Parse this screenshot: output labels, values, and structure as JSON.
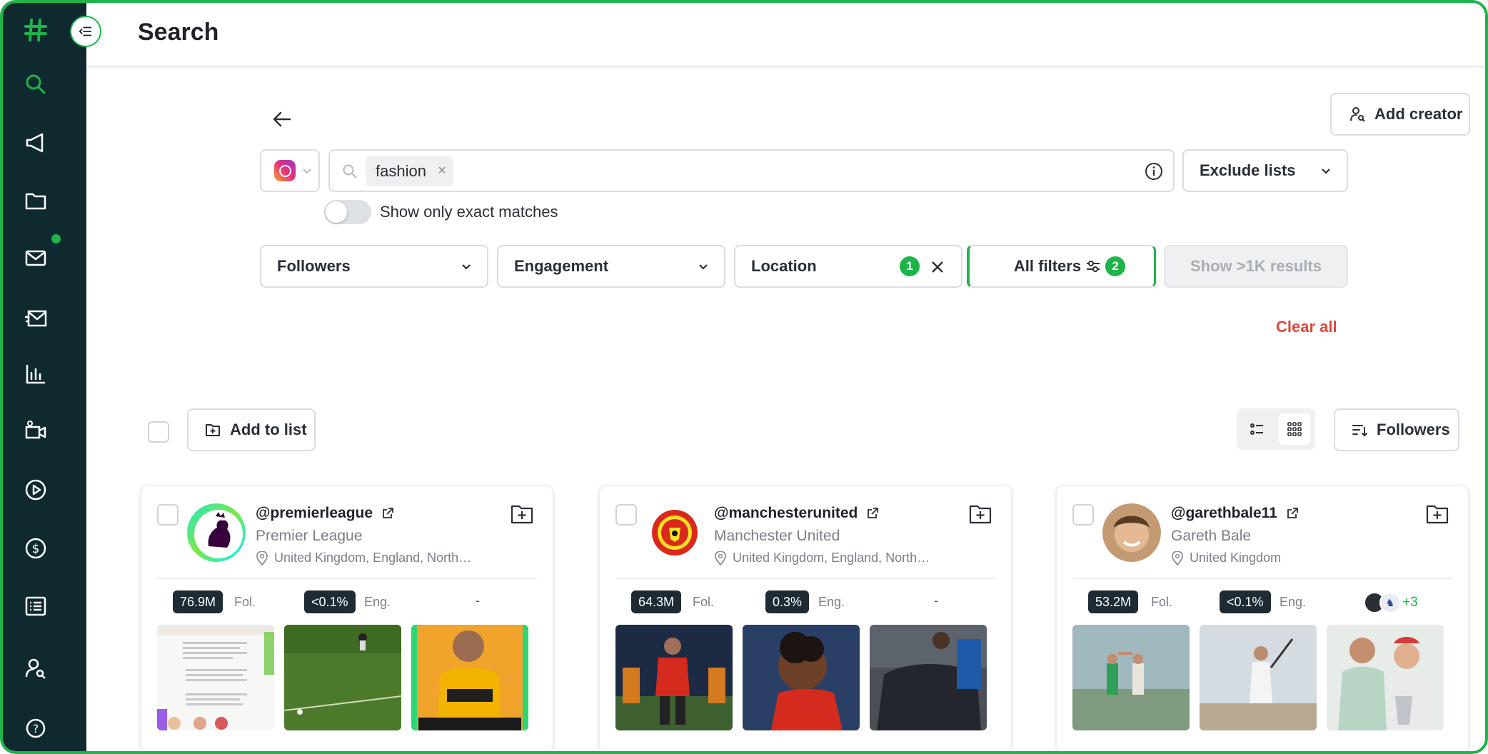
{
  "app": {
    "title": "Search"
  },
  "sidebar": {
    "items": [
      {
        "icon": "logo-icon"
      },
      {
        "icon": "search-icon"
      },
      {
        "icon": "megaphone-icon"
      },
      {
        "icon": "folder-icon"
      },
      {
        "icon": "mail-icon",
        "notification": true
      },
      {
        "icon": "send-mail-icon"
      },
      {
        "icon": "bar-chart-icon"
      },
      {
        "icon": "video-camera-icon"
      },
      {
        "icon": "play-icon"
      },
      {
        "icon": "dollar-icon"
      },
      {
        "icon": "list-icon"
      },
      {
        "icon": "user-search-icon"
      },
      {
        "icon": "help-icon"
      }
    ]
  },
  "toolbar": {
    "add_creator_label": "Add creator",
    "exclude_lists_label": "Exclude lists",
    "show_exact_label": "Show only exact matches"
  },
  "search": {
    "chip": "fashion",
    "chip_remove": "×"
  },
  "filters": {
    "followers": "Followers",
    "engagement": "Engagement",
    "location": "Location",
    "location_count": "1",
    "all_filters": "All filters",
    "all_filters_count": "2",
    "show_results": "Show >1K results",
    "clear_all": "Clear all"
  },
  "results": {
    "add_to_list": "Add to list",
    "sort_label": "Followers"
  },
  "cards": [
    {
      "handle": "@premierleague",
      "name": "Premier League",
      "location": "United Kingdom, England, North…",
      "followers": "76.9M",
      "followers_label": "Fol.",
      "engagement": "<0.1%",
      "engagement_label": "Eng.",
      "extra": "-"
    },
    {
      "handle": "@manchesterunited",
      "name": "Manchester United",
      "location": "United Kingdom, England, North…",
      "followers": "64.3M",
      "followers_label": "Fol.",
      "engagement": "0.3%",
      "engagement_label": "Eng.",
      "extra": "-"
    },
    {
      "handle": "@garethbale11",
      "name": "Gareth Bale",
      "location": "United Kingdom",
      "followers": "53.2M",
      "followers_label": "Fol.",
      "engagement": "<0.1%",
      "engagement_label": "Eng.",
      "extra": "+3"
    }
  ],
  "colors": {
    "accent": "#1db44a",
    "sidebar": "#0f2a2f",
    "danger": "#e0473a",
    "pill": "#1f2a33"
  }
}
